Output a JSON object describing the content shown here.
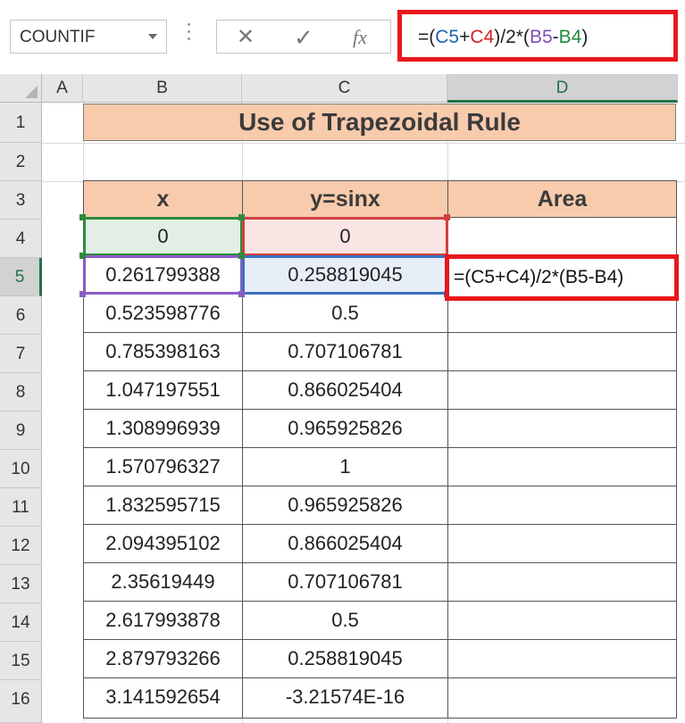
{
  "formula_bar": {
    "name_box": "COUNTIF",
    "cancel_icon": "✕",
    "enter_icon": "✓",
    "function_icon": "fx",
    "formula_parts": [
      "=(",
      "C5",
      "+",
      "C4",
      ")/2*(",
      "B5",
      "-",
      "B4",
      ")"
    ]
  },
  "colors": {
    "title_fill": "#f8cbad",
    "highlight_box": "#e8171d",
    "ref_c5": "#1f5fb5",
    "ref_c4": "#d32020",
    "ref_b5": "#7b4fb3",
    "ref_b4": "#1f8a3a",
    "selected_header": "#217346"
  },
  "columns": [
    "A",
    "B",
    "C",
    "D"
  ],
  "rows": [
    "1",
    "2",
    "3",
    "4",
    "5",
    "6",
    "7",
    "8",
    "9",
    "10",
    "11",
    "12",
    "13",
    "14",
    "15",
    "16"
  ],
  "sheet": {
    "title": "Use of Trapezoidal Rule",
    "headers": [
      "x",
      "y=sinx",
      "Area"
    ],
    "active_cell_formula": "=(C5+C4)/2*(B5-B4)",
    "data": [
      [
        "0",
        "0"
      ],
      [
        "0.261799388",
        "0.258819045"
      ],
      [
        "0.523598776",
        "0.5"
      ],
      [
        "0.785398163",
        "0.707106781"
      ],
      [
        "1.047197551",
        "0.866025404"
      ],
      [
        "1.308996939",
        "0.965925826"
      ],
      [
        "1.570796327",
        "1"
      ],
      [
        "1.832595715",
        "0.965925826"
      ],
      [
        "2.094395102",
        "0.866025404"
      ],
      [
        "2.35619449",
        "0.707106781"
      ],
      [
        "2.617993878",
        "0.5"
      ],
      [
        "2.879793266",
        "0.258819045"
      ],
      [
        "3.141592654",
        "-3.21574E-16"
      ]
    ]
  }
}
